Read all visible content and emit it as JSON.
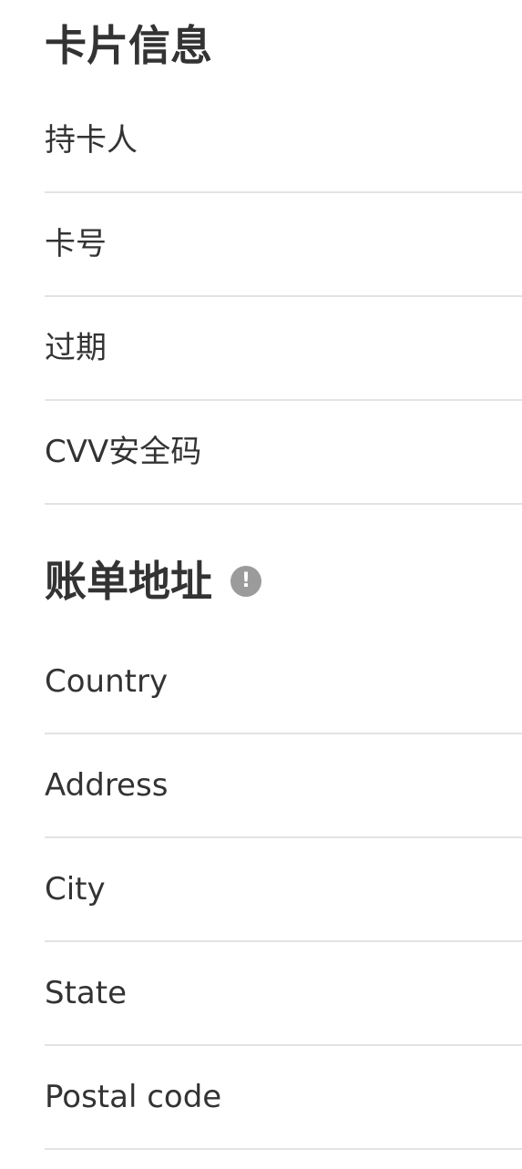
{
  "card_section": {
    "title": "卡片信息",
    "fields": {
      "cardholder": {
        "label": "持卡人",
        "value": ""
      },
      "card_number": {
        "label": "卡号",
        "value": ""
      },
      "expiry": {
        "label": "过期",
        "value": ""
      },
      "cvv": {
        "label": "CVV安全码",
        "value": ""
      }
    }
  },
  "billing_section": {
    "title": "账单地址",
    "info_icon": "exclamation-info-icon",
    "info_glyph": "!",
    "fields": {
      "country": {
        "label": "Country",
        "value": ""
      },
      "address": {
        "label": "Address",
        "value": ""
      },
      "city": {
        "label": "City",
        "value": ""
      },
      "state": {
        "label": "State",
        "value": ""
      },
      "postal_code": {
        "label": "Postal code",
        "value": ""
      }
    }
  },
  "colors": {
    "text": "#333333",
    "divider": "#e3e3e3",
    "info_icon_bg": "#9b9b9b",
    "background": "#ffffff"
  }
}
